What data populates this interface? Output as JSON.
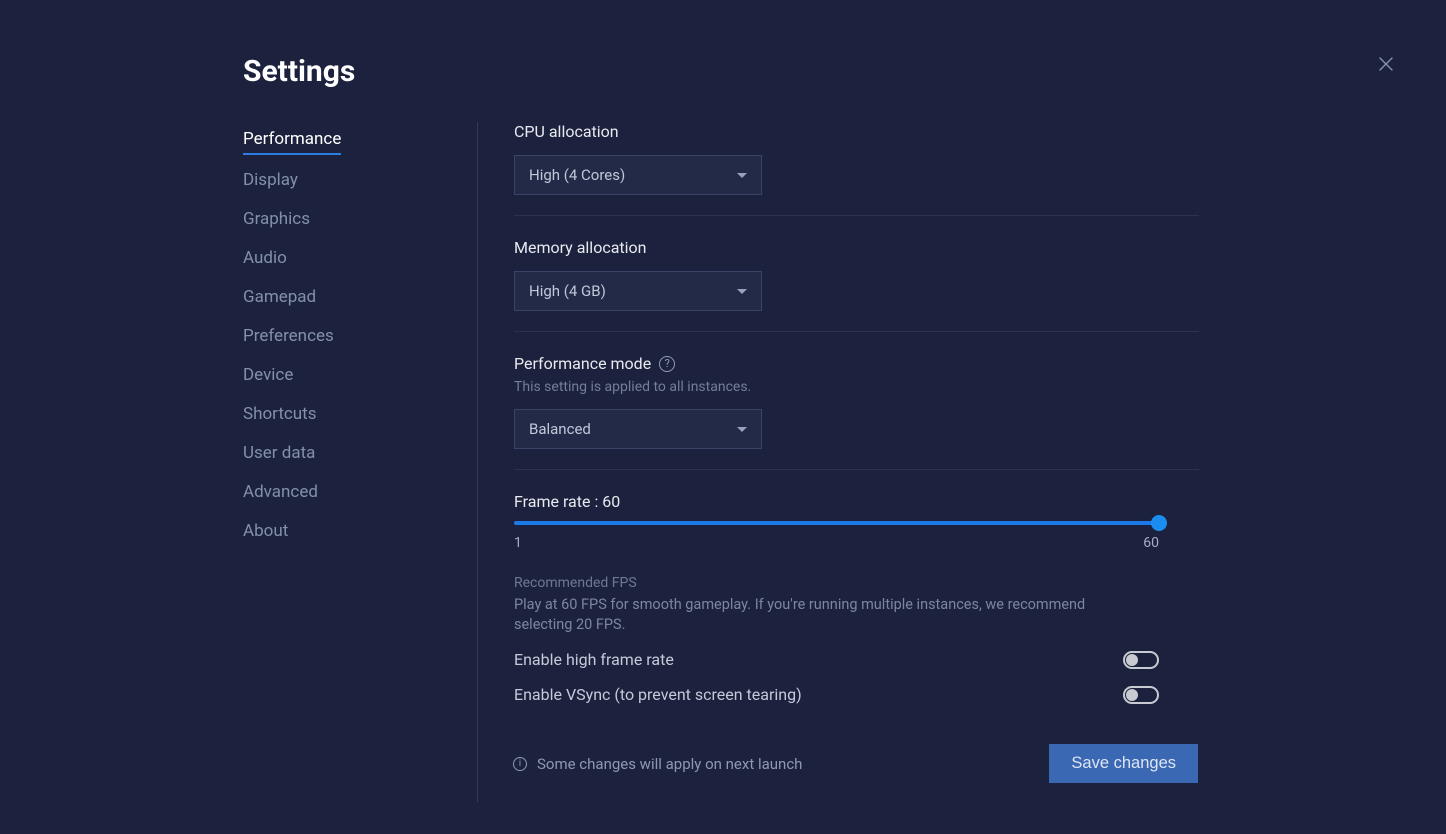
{
  "title": "Settings",
  "sidebar": {
    "items": [
      {
        "label": "Performance",
        "active": true
      },
      {
        "label": "Display"
      },
      {
        "label": "Graphics"
      },
      {
        "label": "Audio"
      },
      {
        "label": "Gamepad"
      },
      {
        "label": "Preferences"
      },
      {
        "label": "Device"
      },
      {
        "label": "Shortcuts"
      },
      {
        "label": "User data"
      },
      {
        "label": "Advanced"
      },
      {
        "label": "About"
      }
    ]
  },
  "main": {
    "cpu": {
      "label": "CPU allocation",
      "value": "High (4 Cores)"
    },
    "memory": {
      "label": "Memory allocation",
      "value": "High (4 GB)"
    },
    "perfmode": {
      "label": "Performance mode",
      "sub": "This setting is applied to all instances.",
      "value": "Balanced"
    },
    "framerate": {
      "label": "Frame rate : 60",
      "min": "1",
      "max": "60",
      "rec_head": "Recommended FPS",
      "rec_body": "Play at 60 FPS for smooth gameplay. If you're running multiple instances, we recommend selecting 20 FPS."
    },
    "toggles": {
      "high_fr": "Enable high frame rate",
      "vsync": "Enable VSync (to prevent screen tearing)"
    }
  },
  "footer": {
    "note": "Some changes will apply on next launch",
    "save": "Save changes"
  }
}
